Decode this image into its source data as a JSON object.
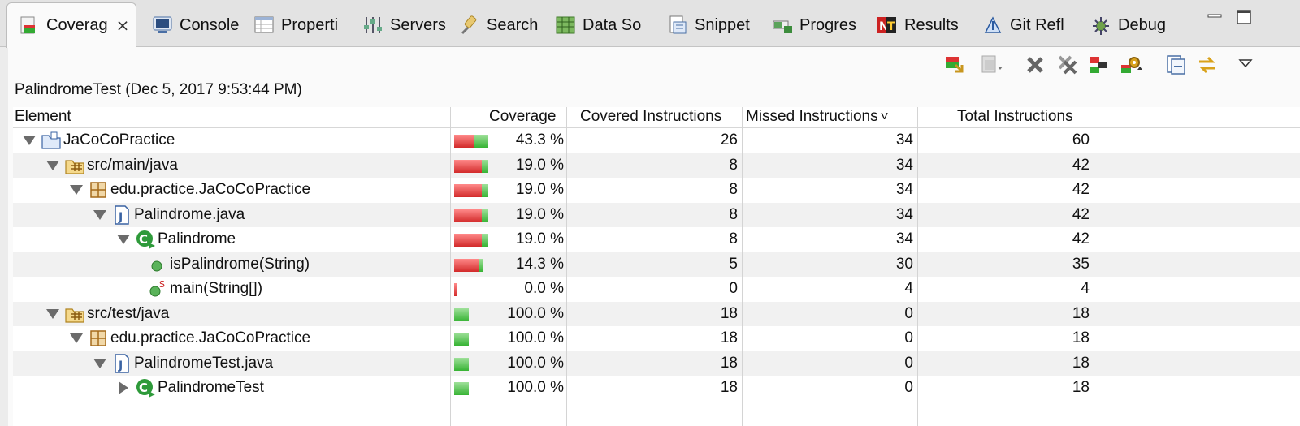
{
  "tabs": [
    {
      "label": "Coverag",
      "icon": "coverage-icon",
      "active": true
    },
    {
      "label": "Console",
      "icon": "console-icon"
    },
    {
      "label": "Properti",
      "icon": "properties-icon"
    },
    {
      "label": "Servers",
      "icon": "servers-icon"
    },
    {
      "label": "Search",
      "icon": "search-icon"
    },
    {
      "label": "Data So",
      "icon": "data-source-icon"
    },
    {
      "label": "Snippet",
      "icon": "snippet-icon"
    },
    {
      "label": "Progres",
      "icon": "progress-icon"
    },
    {
      "label": "Results",
      "icon": "results-icon"
    },
    {
      "label": "Git Refl",
      "icon": "git-reflog-icon"
    },
    {
      "label": "Debug",
      "icon": "debug-icon"
    }
  ],
  "tab_close_glyph": "⨯",
  "window_controls": {
    "minimize": "minimize-icon",
    "maximize": "maximize-icon"
  },
  "toolbar_icons": [
    "relaunch-icon",
    "dump-execution-icon",
    "remove-session-icon",
    "remove-all-sessions-icon",
    "merge-sessions-icon",
    "select-counters-icon",
    "collapse-all-icon",
    "link-with-selection-icon",
    "view-menu-icon"
  ],
  "session_title": "PalindromeTest (Dec 5, 2017 9:53:44 PM)",
  "columns": {
    "element": "Element",
    "coverage": "Coverage",
    "covered": "Covered Instructions",
    "missed": "Missed Instructions",
    "total": "Total Instructions",
    "sort_indicator": "˅"
  },
  "rows": [
    {
      "name": "JaCoCoPractice",
      "icon": "project-icon",
      "depth": 0,
      "expander": "down",
      "coverage": "43.3 %",
      "covered": "26",
      "missed": "34",
      "total": "60",
      "ratio": 0.433
    },
    {
      "name": "src/main/java",
      "icon": "source-folder-icon",
      "depth": 1,
      "expander": "down",
      "coverage": "19.0 %",
      "covered": "8",
      "missed": "34",
      "total": "42",
      "ratio": 0.19
    },
    {
      "name": "edu.practice.JaCoCoPractice",
      "icon": "package-icon",
      "depth": 2,
      "expander": "down",
      "coverage": "19.0 %",
      "covered": "8",
      "missed": "34",
      "total": "42",
      "ratio": 0.19
    },
    {
      "name": "Palindrome.java",
      "icon": "java-file-icon",
      "depth": 3,
      "expander": "down",
      "coverage": "19.0 %",
      "covered": "8",
      "missed": "34",
      "total": "42",
      "ratio": 0.19
    },
    {
      "name": "Palindrome",
      "icon": "class-icon",
      "depth": 4,
      "expander": "down",
      "coverage": "19.0 %",
      "covered": "8",
      "missed": "34",
      "total": "42",
      "ratio": 0.19
    },
    {
      "name": "isPalindrome(String)",
      "icon": "method-icon",
      "depth": 5,
      "expander": "none",
      "coverage": "14.3 %",
      "covered": "5",
      "missed": "30",
      "total": "35",
      "ratio": 0.143
    },
    {
      "name": "main(String[])",
      "icon": "static-method-icon",
      "depth": 5,
      "expander": "none",
      "coverage": "0.0 %",
      "covered": "0",
      "missed": "4",
      "total": "4",
      "ratio": 0.0
    },
    {
      "name": "src/test/java",
      "icon": "source-folder-icon",
      "depth": 1,
      "expander": "down",
      "coverage": "100.0 %",
      "covered": "18",
      "missed": "0",
      "total": "18",
      "ratio": 1.0
    },
    {
      "name": "edu.practice.JaCoCoPractice",
      "icon": "package-icon",
      "depth": 2,
      "expander": "down",
      "coverage": "100.0 %",
      "covered": "18",
      "missed": "0",
      "total": "18",
      "ratio": 1.0
    },
    {
      "name": "PalindromeTest.java",
      "icon": "java-file-icon",
      "depth": 3,
      "expander": "down",
      "coverage": "100.0 %",
      "covered": "18",
      "missed": "0",
      "total": "18",
      "ratio": 1.0
    },
    {
      "name": "PalindromeTest",
      "icon": "class-icon",
      "depth": 4,
      "expander": "right",
      "coverage": "100.0 %",
      "covered": "18",
      "missed": "0",
      "total": "18",
      "ratio": 1.0
    }
  ],
  "colors": {
    "covered": "#36b333",
    "missed": "#d22a2a"
  }
}
